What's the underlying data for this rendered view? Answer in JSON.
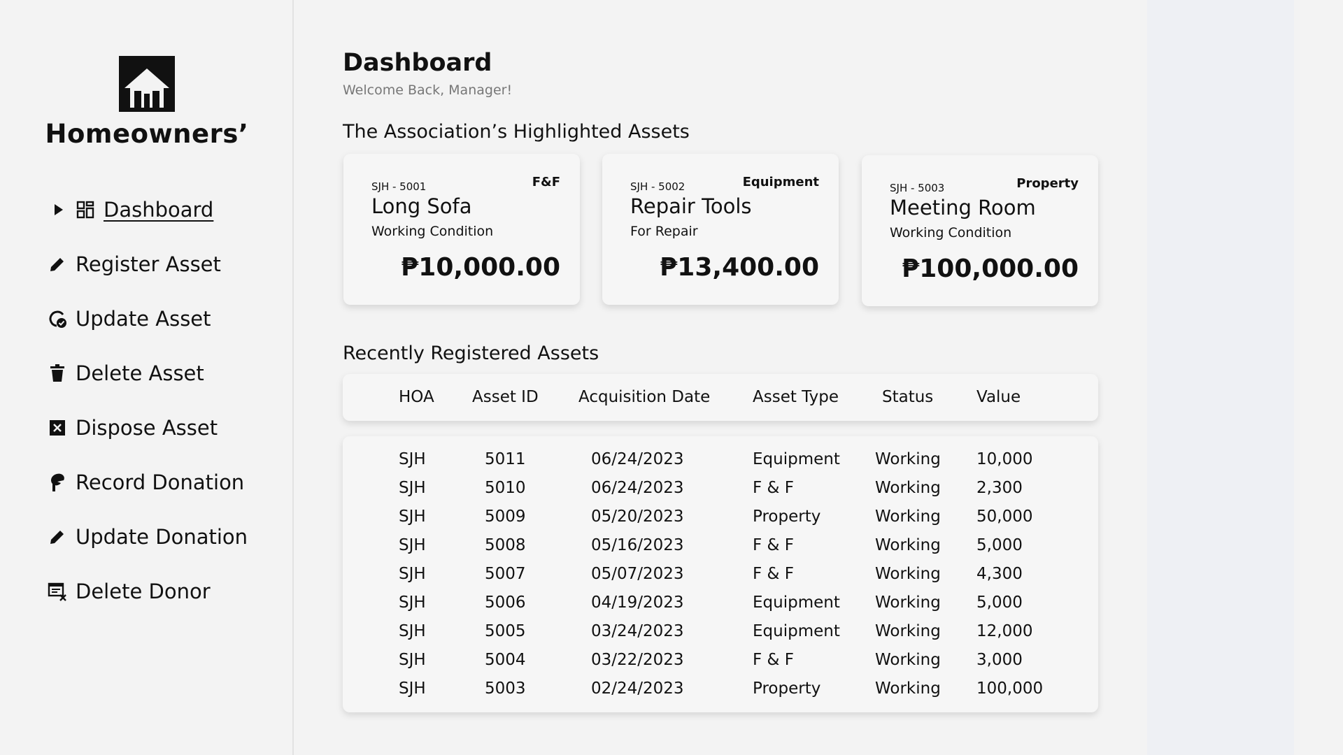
{
  "sidebar": {
    "brand": "Homeowners’",
    "items": [
      {
        "label": "Dashboard",
        "icon": "dashboard-icon"
      },
      {
        "label": "Register Asset",
        "icon": "pencil-icon"
      },
      {
        "label": "Update Asset",
        "icon": "refresh-check-icon"
      },
      {
        "label": "Delete Asset",
        "icon": "trash-icon"
      },
      {
        "label": "Dispose  Asset",
        "icon": "x-box-icon"
      },
      {
        "label": "Record Donation",
        "icon": "hand-icon"
      },
      {
        "label": "Update Donation",
        "icon": "pencil-icon"
      },
      {
        "label": "Delete Donor",
        "icon": "list-x-icon"
      }
    ]
  },
  "header": {
    "title": "Dashboard",
    "subtitle": "Welcome Back, Manager!"
  },
  "highlighted": {
    "title": "The Association’s Highlighted Assets",
    "cards": [
      {
        "id": "SJH - 5001",
        "type": "F&F",
        "name": "Long Sofa",
        "condition": "Working Condition",
        "value": "₱10,000.00"
      },
      {
        "id": "SJH - 5002",
        "type": "Equipment",
        "name": "Repair Tools",
        "condition": "For Repair",
        "value": "₱13,400.00"
      },
      {
        "id": "SJH - 5003",
        "type": "Property",
        "name": "Meeting Room",
        "condition": "Working Condition",
        "value": "₱100,000.00"
      }
    ]
  },
  "recent": {
    "title": "Recently Registered Assets",
    "headers": [
      "HOA",
      "Asset ID",
      "Acquisition Date",
      "Asset Type",
      "Status",
      "Value"
    ],
    "rows": [
      [
        "SJH",
        "5011",
        "06/24/2023",
        "Equipment",
        "Working",
        "10,000"
      ],
      [
        "SJH",
        "5010",
        "06/24/2023",
        "F & F",
        "Working",
        "2,300"
      ],
      [
        "SJH",
        "5009",
        "05/20/2023",
        "Property",
        "Working",
        "50,000"
      ],
      [
        "SJH",
        "5008",
        "05/16/2023",
        "F & F",
        "Working",
        "5,000"
      ],
      [
        "SJH",
        "5007",
        "05/07/2023",
        "F & F",
        "Working",
        "4,300"
      ],
      [
        "SJH",
        "5006",
        "04/19/2023",
        "Equipment",
        "Working",
        "5,000"
      ],
      [
        "SJH",
        "5005",
        "03/24/2023",
        "Equipment",
        "Working",
        "12,000"
      ],
      [
        "SJH",
        "5004",
        "03/22/2023",
        "F & F",
        "Working",
        "3,000"
      ],
      [
        "SJH",
        "5003",
        "02/24/2023",
        "Property",
        "Working",
        "100,000"
      ]
    ]
  }
}
